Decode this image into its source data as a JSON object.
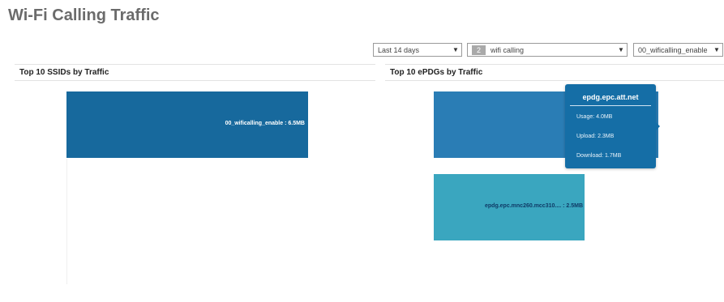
{
  "page": {
    "title": "Wi-Fi Calling Traffic"
  },
  "filters": {
    "time_range": {
      "value": "Last 14 days"
    },
    "category": {
      "count": "2",
      "value": "wifi calling"
    },
    "ssid": {
      "value": "00_wificalling_enable"
    }
  },
  "panels": {
    "ssids": {
      "title": "Top 10 SSIDs by Traffic",
      "bars": [
        {
          "label": "00_wificalling_enable : 6.5MB",
          "value_mb": 6.5,
          "color": "#17699d"
        }
      ]
    },
    "epdgs": {
      "title": "Top 10 ePDGs by Traffic",
      "bars": [
        {
          "label": "",
          "value_mb": 4.0,
          "color": "#2a7db5"
        },
        {
          "label": "epdg.epc.mnc260.mcc310.... : 2.5MB",
          "value_mb": 2.5,
          "color": "#3aa6bf"
        }
      ]
    }
  },
  "tooltip": {
    "title": "epdg.epc.att.net",
    "rows": [
      "Usage: 4.0MB",
      "Upload: 2.3MB",
      "Download: 1.7MB"
    ]
  },
  "colors": {
    "ssid_bar": "#17699d",
    "epdg_bar_1": "#2a7db5",
    "epdg_bar_2": "#3aa6bf",
    "tooltip_bg": "#156ea6"
  }
}
